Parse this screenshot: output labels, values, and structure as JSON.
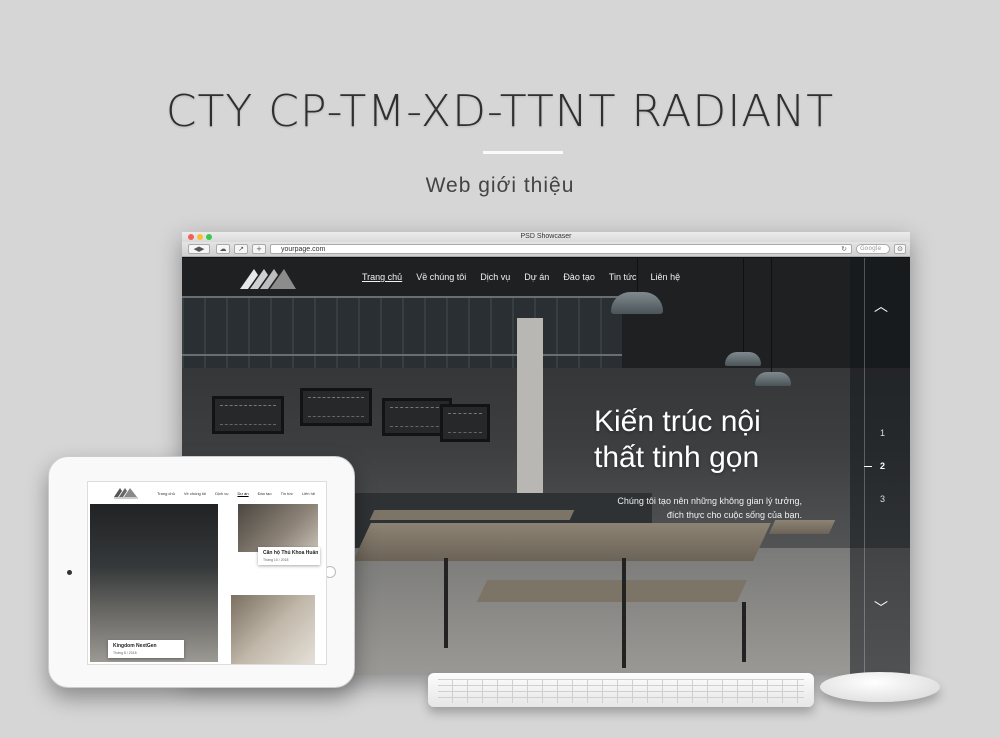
{
  "header": {
    "title": "CTY CP-TM-XD-TTNT RADIANT",
    "subtitle": "Web giới thiệu"
  },
  "browser": {
    "window_title": "PSD Showcaser",
    "url": "yourpage.com",
    "search_placeholder": "Google",
    "reload_icon": "↻",
    "back_icon": "◀▶"
  },
  "site": {
    "nav": [
      {
        "label": "Trang chủ",
        "active": true
      },
      {
        "label": "Về chúng tôi",
        "active": false
      },
      {
        "label": "Dịch vụ",
        "active": false
      },
      {
        "label": "Dự án",
        "active": false
      },
      {
        "label": "Đào tạo",
        "active": false
      },
      {
        "label": "Tin tức",
        "active": false
      },
      {
        "label": "Liên hệ",
        "active": false
      }
    ],
    "hero": {
      "heading_line1": "Kiến trúc nội",
      "heading_line2": "thất tinh gọn",
      "desc_line1": "Chúng tôi tạo nên những không gian lý tưởng,",
      "desc_line2": "đích thực cho cuộc sống của bạn."
    },
    "slider": {
      "up_icon": "chevron-up-icon",
      "down_icon": "chevron-down-icon",
      "pages": [
        "1",
        "2",
        "3"
      ],
      "active_page": "2"
    }
  },
  "tablet": {
    "nav": [
      "Trang chủ",
      "Về chúng tôi",
      "Dịch vụ",
      "Dự án",
      "Đào tạo",
      "Tin tức",
      "Liên hệ"
    ],
    "active_nav": "Dự án",
    "cards": [
      {
        "title": "Kingdom NextGen",
        "date": "Tháng 8 / 2018"
      },
      {
        "title": "Căn hộ Thủ Khoa Huân",
        "date": "Tháng 10 / 2018"
      }
    ]
  },
  "colors": {
    "background": "#d6d6d6",
    "title": "#2f2f2f"
  }
}
